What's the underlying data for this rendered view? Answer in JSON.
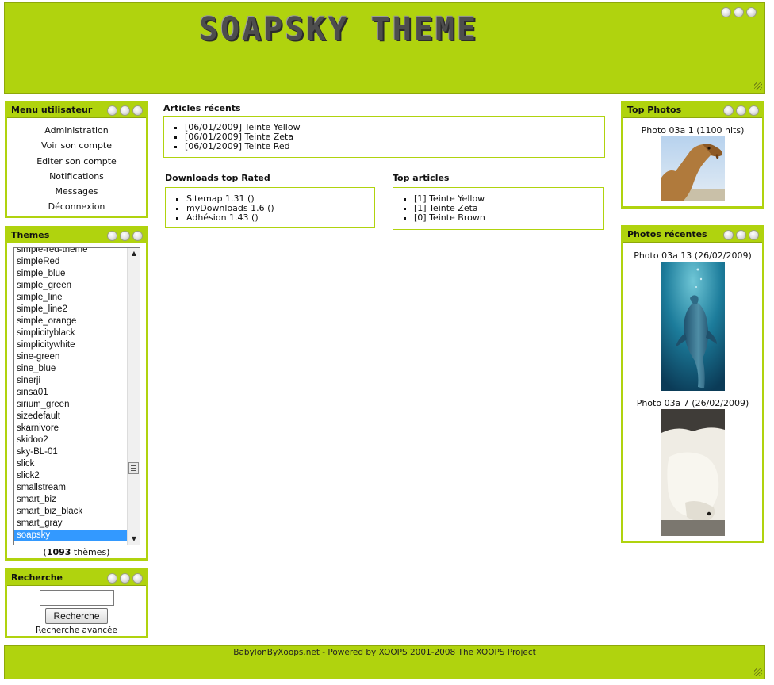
{
  "header": {
    "title": "SOAPSKY THEME"
  },
  "user_menu": {
    "title": "Menu utilisateur",
    "items": [
      "Administration",
      "Voir son compte",
      "Editer son compte",
      "Notifications",
      "Messages",
      "Déconnexion"
    ]
  },
  "themes": {
    "title": "Themes",
    "options": [
      "simple-red-theme",
      "simpleRed",
      "simple_blue",
      "simple_green",
      "simple_line",
      "simple_line2",
      "simple_orange",
      "simplicityblack",
      "simplicitywhite",
      "sine-green",
      "sine_blue",
      "sinerji",
      "sinsa01",
      "sirium_green",
      "sizedefault",
      "skarnivore",
      "skidoo2",
      "sky-BL-01",
      "slick",
      "slick2",
      "smallstream",
      "smart_biz",
      "smart_biz_black",
      "smart_gray",
      "soapsky"
    ],
    "selected": "soapsky",
    "count": "1093",
    "count_suffix": " thèmes)",
    "count_prefix": "("
  },
  "search": {
    "title": "Recherche",
    "input_value": "",
    "button_label": "Recherche",
    "advanced_label": "Recherche avancée"
  },
  "recent_articles": {
    "title": "Articles récents",
    "items": [
      "[06/01/2009] Teinte Yellow",
      "[06/01/2009] Teinte Zeta",
      "[06/01/2009] Teinte Red"
    ]
  },
  "downloads_top_rated": {
    "title": "Downloads top Rated",
    "items": [
      "Sitemap 1.31 ()",
      "myDownloads 1.6 ()",
      "Adhésion 1.43 ()"
    ]
  },
  "top_articles": {
    "title": "Top articles",
    "items": [
      "[1] Teinte Yellow",
      "[1] Teinte Zeta",
      "[0] Teinte Brown"
    ]
  },
  "top_photos": {
    "title": "Top Photos",
    "photos": [
      {
        "caption": "Photo 03a 1 (1100 hits)",
        "subject": "camel"
      }
    ]
  },
  "recent_photos": {
    "title": "Photos récentes",
    "photos": [
      {
        "caption": "Photo 03a 13 (26/02/2009)",
        "subject": "dolphin"
      },
      {
        "caption": "Photo 03a 7 (26/02/2009)",
        "subject": "polar-bear"
      }
    ]
  },
  "footer": {
    "text": "BabylonByXoops.net - Powered by XOOPS 2001-2008 The XOOPS Project"
  },
  "colors": {
    "accent": "#b0d30e",
    "selection": "#3399ff"
  }
}
